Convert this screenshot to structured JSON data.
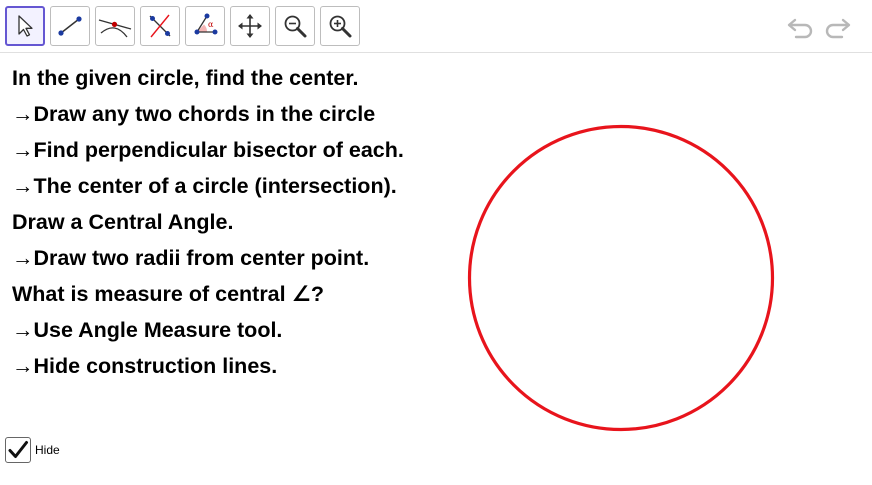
{
  "toolbar": {
    "tools": [
      {
        "name": "Move",
        "icon": "move-arrow-icon"
      },
      {
        "name": "Segment",
        "icon": "segment-icon"
      },
      {
        "name": "Intersect",
        "icon": "intersect-icon"
      },
      {
        "name": "Perpendicular Bisector",
        "icon": "perpendicular-bisector-icon"
      },
      {
        "name": "Angle",
        "icon": "angle-icon"
      },
      {
        "name": "Move Graphics View",
        "icon": "move-graphics-view-icon"
      },
      {
        "name": "Zoom Out",
        "icon": "zoom-out-icon"
      },
      {
        "name": "Zoom In",
        "icon": "zoom-in-icon"
      }
    ],
    "selected_tool": "Move",
    "undo_icon": "undo-icon",
    "redo_icon": "redo-icon"
  },
  "instructions": [
    "In the given circle, find the center.",
    "→Draw any two chords in the circle",
    "→Find perpendicular bisector of each.",
    "→The center of a circle (intersection).",
    "Draw a Central Angle.",
    "→Draw two radii from center point.",
    "What is measure of central ∠?",
    "→Use Angle Measure tool.",
    "→Hide construction lines."
  ],
  "circle": {
    "color": "#e8141c"
  },
  "hide_checkbox": {
    "label": "Hide",
    "checked": true
  },
  "colors": {
    "accent": "#6557d2",
    "point": "#1b3aa0",
    "circle": "#e8141c"
  }
}
